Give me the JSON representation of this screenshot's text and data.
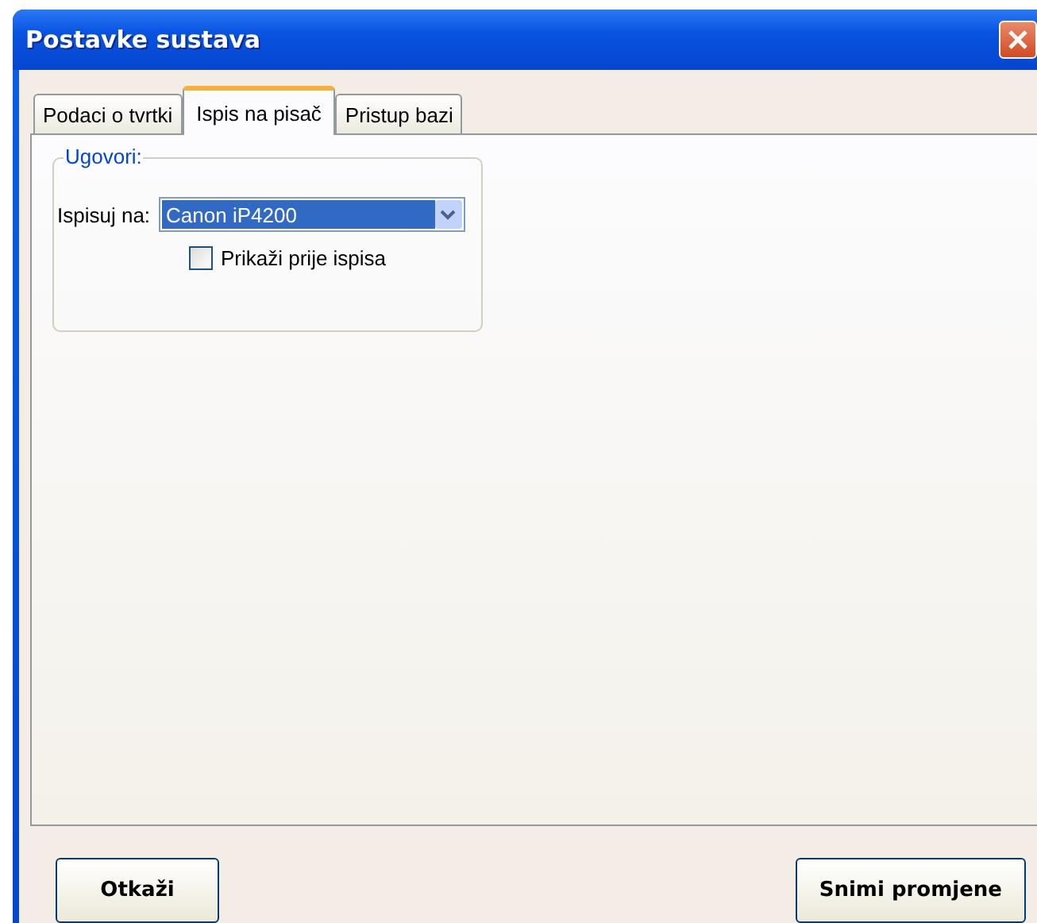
{
  "window": {
    "title": "Postavke sustava"
  },
  "tabs": [
    {
      "label": "Podaci o tvrtki",
      "selected": false
    },
    {
      "label": "Ispis na pisač",
      "selected": true
    },
    {
      "label": "Pristup bazi",
      "selected": false
    }
  ],
  "group": {
    "title": "Ugovori:",
    "printer_label": "Ispisuj na:",
    "printer_value": "Canon iP4200",
    "preview": {
      "label": "Prikaži prije ispisa",
      "checked": false
    }
  },
  "buttons": [
    {
      "label": "Otkaži"
    },
    {
      "label": "Snimi promjene"
    }
  ]
}
